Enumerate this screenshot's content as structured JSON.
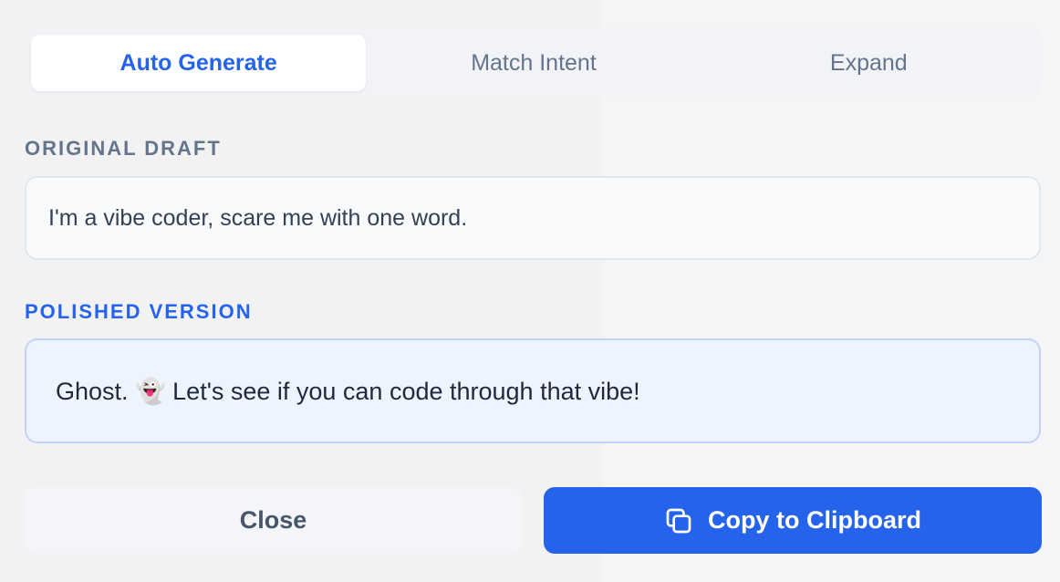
{
  "tabs": [
    {
      "label": "Auto Generate",
      "active": true
    },
    {
      "label": "Match Intent",
      "active": false
    },
    {
      "label": "Expand",
      "active": false
    }
  ],
  "original": {
    "label": "ORIGINAL DRAFT",
    "text": "I'm a vibe coder, scare me with one word."
  },
  "polished": {
    "label": "POLISHED VERSION",
    "text": "Ghost. 👻 Let's see if you can code through that vibe!"
  },
  "buttons": {
    "close_label": "Close",
    "copy_label": "Copy to Clipboard",
    "copy_icon": "copy-icon"
  },
  "colors": {
    "accent": "#2563eb",
    "muted": "#64748b"
  }
}
